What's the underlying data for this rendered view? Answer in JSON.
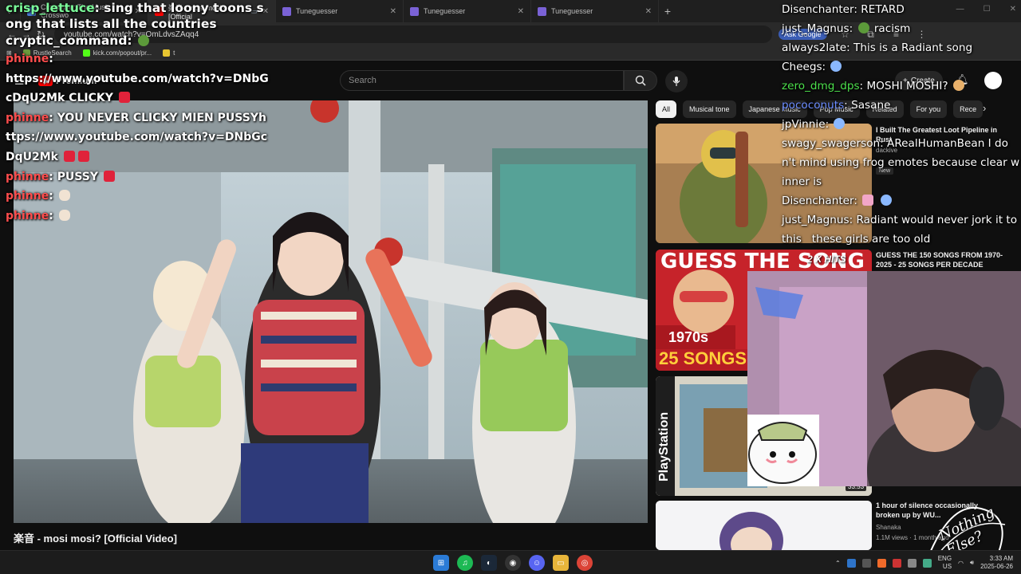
{
  "browser": {
    "tabs": [
      {
        "label": "Crosstune: The Music Crosswo",
        "color": "#4a7bd8"
      },
      {
        "label": "楽音 - mosi mosi? [Official",
        "color": "#ff0000",
        "active": true
      },
      {
        "label": "Tuneguesser",
        "color": "#7a62d6"
      },
      {
        "label": "Tuneguesser",
        "color": "#7a62d6"
      },
      {
        "label": "Tuneguesser",
        "color": "#7a62d6"
      }
    ],
    "url": "youtube.com/watch?v=OmLdvsZAqq4",
    "ask_google": "Ask Google",
    "bookmarks": [
      "RustleSearch",
      "kick.com/popout/pr...",
      "t"
    ]
  },
  "youtube": {
    "logo_text": "Premium",
    "logo_region": "CA",
    "search_placeholder": "Search",
    "create_label": "Create",
    "chips": [
      "All",
      "Musical tone",
      "Japanese Music",
      "Pop Music",
      "Related",
      "For you",
      "Rece"
    ],
    "video_title": "楽音 - mosi mosi? [Official Video]",
    "recommendations": [
      {
        "title": "I Built The Greatest Loot Pipeline in Rust",
        "channel": "dackive",
        "badge": "New"
      },
      {
        "title": "GUESS THE 150 SONGS FROM 1970-2025 - 25 SONGS PER DECADE",
        "thumb_text": "GUESS THE SONG",
        "thumb_year": "1970s",
        "thumb_count": "25 SONGS",
        "overlay": "2 X HITS"
      },
      {
        "title": "",
        "thumb_text": "PlayStation",
        "duration": "33:53"
      },
      {
        "title": "1 hour of silence occasionally broken up by WU...",
        "channel": "Shanaka",
        "meta": "1.1M views · 1 month ago"
      }
    ]
  },
  "chat_left": [
    {
      "user": "crisp_lettuce",
      "user_color": "green",
      "text": "sing that loony toons song that lists all the countries"
    },
    {
      "user": "cryptic_command",
      "user_color": "green",
      "text": ""
    },
    {
      "user": "phinne",
      "text": ""
    },
    {
      "user": "",
      "text": "https://www.youtube.com/watch?v=DNbGcDqU2Mk CLICKY"
    },
    {
      "user": "phinne",
      "text": "YOU NEVER CLICKY MIEN PUSSYhttps://www.youtube.com/watch?v=DNbGcDqU2Mk"
    },
    {
      "user": "phinne",
      "text": "PUSSY"
    },
    {
      "user": "phinne",
      "text": ""
    },
    {
      "user": "phinne",
      "text": ""
    }
  ],
  "chat_right": [
    {
      "user": "Disenchanter",
      "text": "RETARD"
    },
    {
      "user": "just_Magnus",
      "text": "racism"
    },
    {
      "user": "always2late",
      "text": "This is a Radiant song"
    },
    {
      "user": "Cheegs",
      "text": ""
    },
    {
      "user": "zero_dmg_dps",
      "user_color": "green",
      "text": "MOSHI MOSHI?"
    },
    {
      "user": "pococonuts",
      "user_color": "blue",
      "text": "Sasane"
    },
    {
      "user": "jpVinnie",
      "text": ""
    },
    {
      "user": "swagy_swagerson",
      "text": "ARealHumanBean I don't mind using frog emotes because clear winner is"
    },
    {
      "user": "Disenchanter",
      "text": ""
    },
    {
      "user": "just_Magnus",
      "text": "Radiant would never jork it to this   these girls are too old"
    }
  ],
  "overlay": {
    "brand_text": "Nothing Else?"
  },
  "taskbar": {
    "lang": "ENG",
    "region": "US",
    "time": "3:33 AM",
    "date": "2025-06-26"
  },
  "colors": {
    "chat_user_red": "#ff4d4d",
    "chat_user_green": "#7cfc9a",
    "yt_red": "#ff0000"
  }
}
